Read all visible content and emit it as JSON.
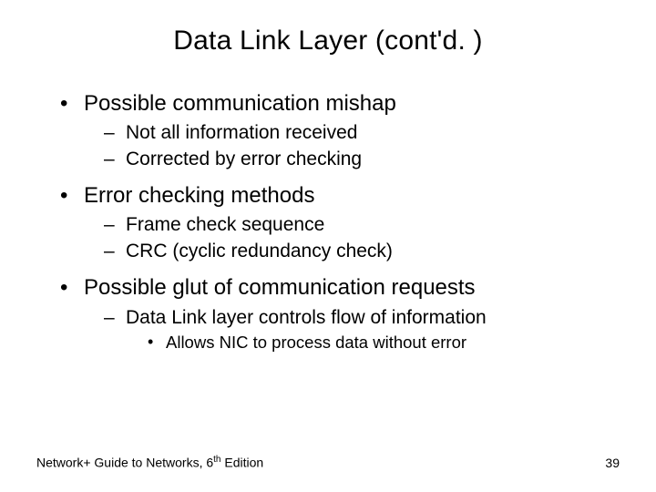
{
  "title": "Data Link Layer (cont'd. )",
  "bullets": [
    {
      "text": "Possible communication mishap",
      "children": [
        {
          "text": "Not all information received"
        },
        {
          "text": "Corrected by error checking"
        }
      ]
    },
    {
      "text": "Error checking methods",
      "children": [
        {
          "text": "Frame check sequence"
        },
        {
          "text": "CRC (cyclic redundancy check)"
        }
      ]
    },
    {
      "text": "Possible glut of communication requests",
      "children": [
        {
          "text": "Data Link layer controls flow of information",
          "children": [
            {
              "text": "Allows NIC to process data without error"
            }
          ]
        }
      ]
    }
  ],
  "footer": {
    "left_prefix": "Network+ Guide to Networks, 6",
    "left_ord": "th",
    "left_suffix": " Edition",
    "page": "39"
  }
}
